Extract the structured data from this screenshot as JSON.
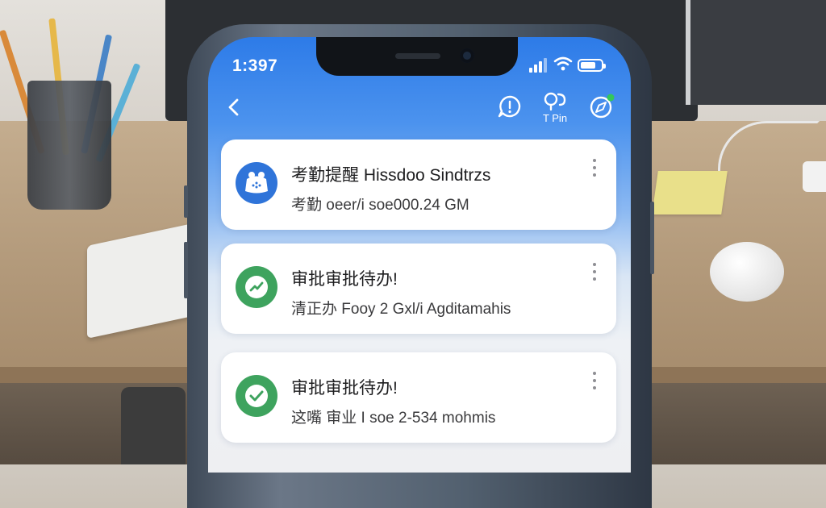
{
  "status_bar": {
    "time": "1:397",
    "battery_level": 0.75
  },
  "nav": {
    "back_icon": "chevron-left-icon",
    "action_icons": [
      "chat-bubble-icon",
      "pin-icon",
      "compass-icon"
    ],
    "pin_label": "T Pin",
    "accent_color": "#2d7be8",
    "badge_color": "#34c759"
  },
  "notifications": [
    {
      "icon": "robot-bell-icon",
      "icon_color": "#2f74d9",
      "title": "考勤提醒 Hissdoo Sindtrzs",
      "subtitle": "考勤  oeer/i soe000.24 GM"
    },
    {
      "icon": "trend-check-icon",
      "icon_color": "#3ea35e",
      "title": "审批审批待办!",
      "subtitle": "清正办  Fooy 2 Gxl/i Agditamahis"
    },
    {
      "icon": "checkmark-icon",
      "icon_color": "#3ea35e",
      "title": "审批审批待办!",
      "subtitle": "这嘴  审业  I soe 2-534 mohmis"
    }
  ]
}
